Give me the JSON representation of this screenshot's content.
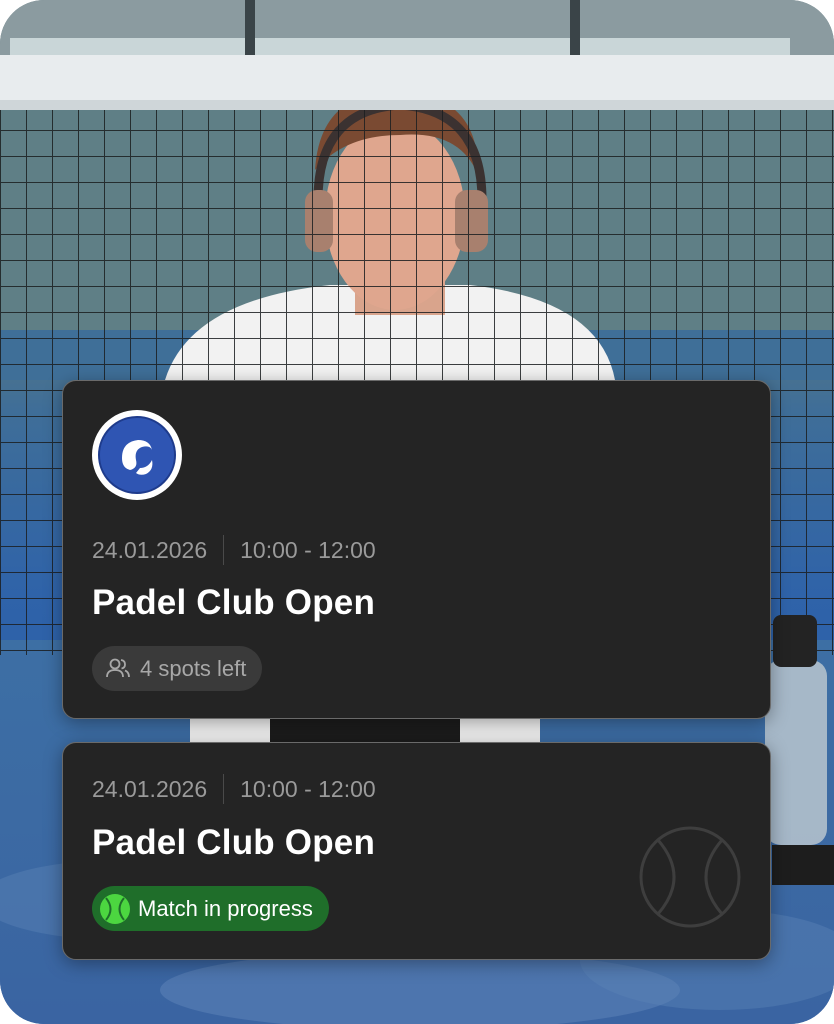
{
  "cards": [
    {
      "logo": "club-logo-icon",
      "date": "24.01.2026",
      "time": "10:00 - 12:00",
      "title": "Padel Club Open",
      "badge_icon": "users-icon",
      "badge": "4 spots left"
    },
    {
      "date": "24.01.2026",
      "time": "10:00 - 12:00",
      "title": "Padel Club Open",
      "badge_icon": "tennis-ball-icon",
      "badge": "Match in progress",
      "decor_icon": "tennis-ball-outline-icon"
    }
  ],
  "colors": {
    "card_bg": "#242424",
    "status_green": "#1f6e2a",
    "ball_green": "#4cd640",
    "logo_blue": "#2f55b3"
  }
}
